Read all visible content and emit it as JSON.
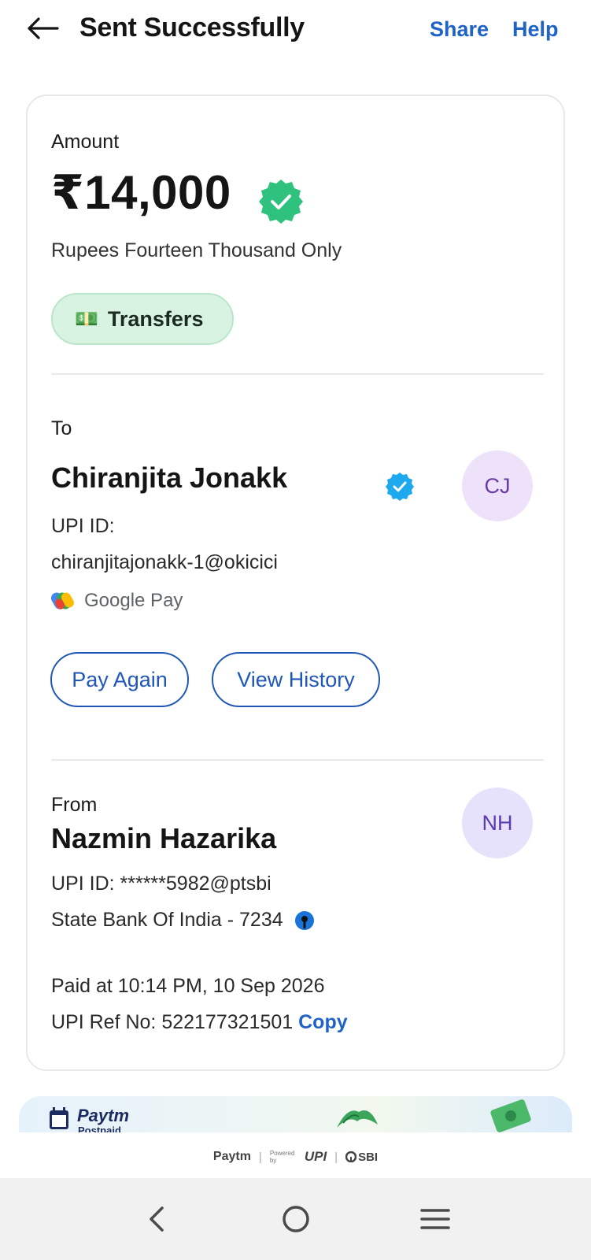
{
  "header": {
    "title": "Sent Successfully",
    "share_label": "Share",
    "help_label": "Help"
  },
  "amount_section": {
    "label": "Amount",
    "amount": "₹14,000",
    "amount_words": "Rupees Fourteen Thousand Only",
    "category_emoji": "💵",
    "category_label": "Transfers"
  },
  "to_section": {
    "label": "To",
    "name": "Chiranjita Jonakk",
    "avatar_initials": "CJ",
    "upi_label": "UPI ID:",
    "upi_id": "chiranjitajonakk-1@okicici",
    "app_name": "Google Pay",
    "pay_again_label": "Pay Again",
    "view_history_label": "View History"
  },
  "from_section": {
    "label": "From",
    "name": "Nazmin Hazarika",
    "avatar_initials": "NH",
    "upi_line": "UPI ID: ******5982@ptsbi",
    "bank_line": "State Bank Of India - 7234"
  },
  "transaction": {
    "paid_at": "Paid at 10:14 PM, 10 Sep 2026",
    "ref_label": "UPI Ref No: 522177321501",
    "copy_label": "Copy"
  },
  "banner": {
    "brand": "Paytm",
    "brand_sub": "Postpaid"
  },
  "footer": {
    "brand_paytm": "Paytm",
    "powered_by": "Powered by",
    "upi": "UPI",
    "sbi": "SBI"
  },
  "colors": {
    "accent_blue": "#1f63c7",
    "success_green": "#2ec27e",
    "pill_green": "#d9f3e2",
    "avatar_purple": "#eee2fb"
  }
}
